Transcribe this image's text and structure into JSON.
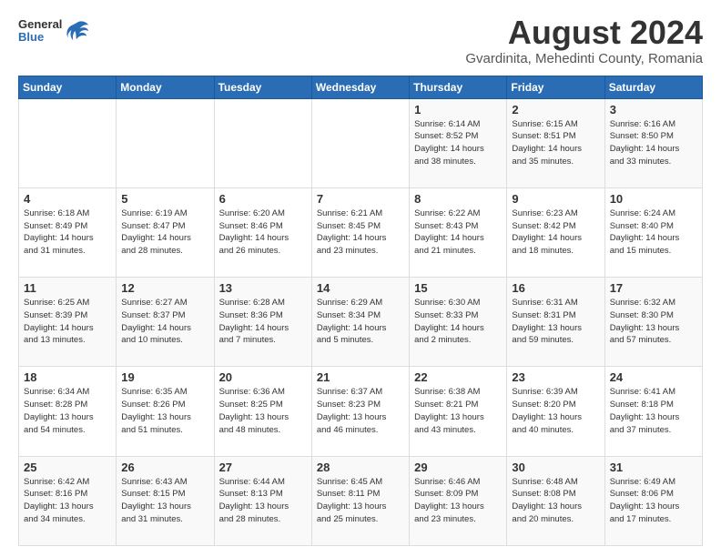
{
  "header": {
    "logo": {
      "general": "General",
      "blue": "Blue"
    },
    "title": "August 2024",
    "subtitle": "Gvardinita, Mehedinti County, Romania"
  },
  "weekdays": [
    "Sunday",
    "Monday",
    "Tuesday",
    "Wednesday",
    "Thursday",
    "Friday",
    "Saturday"
  ],
  "weeks": [
    [
      {
        "day": "",
        "info": ""
      },
      {
        "day": "",
        "info": ""
      },
      {
        "day": "",
        "info": ""
      },
      {
        "day": "",
        "info": ""
      },
      {
        "day": "1",
        "info": "Sunrise: 6:14 AM\nSunset: 8:52 PM\nDaylight: 14 hours\nand 38 minutes."
      },
      {
        "day": "2",
        "info": "Sunrise: 6:15 AM\nSunset: 8:51 PM\nDaylight: 14 hours\nand 35 minutes."
      },
      {
        "day": "3",
        "info": "Sunrise: 6:16 AM\nSunset: 8:50 PM\nDaylight: 14 hours\nand 33 minutes."
      }
    ],
    [
      {
        "day": "4",
        "info": "Sunrise: 6:18 AM\nSunset: 8:49 PM\nDaylight: 14 hours\nand 31 minutes."
      },
      {
        "day": "5",
        "info": "Sunrise: 6:19 AM\nSunset: 8:47 PM\nDaylight: 14 hours\nand 28 minutes."
      },
      {
        "day": "6",
        "info": "Sunrise: 6:20 AM\nSunset: 8:46 PM\nDaylight: 14 hours\nand 26 minutes."
      },
      {
        "day": "7",
        "info": "Sunrise: 6:21 AM\nSunset: 8:45 PM\nDaylight: 14 hours\nand 23 minutes."
      },
      {
        "day": "8",
        "info": "Sunrise: 6:22 AM\nSunset: 8:43 PM\nDaylight: 14 hours\nand 21 minutes."
      },
      {
        "day": "9",
        "info": "Sunrise: 6:23 AM\nSunset: 8:42 PM\nDaylight: 14 hours\nand 18 minutes."
      },
      {
        "day": "10",
        "info": "Sunrise: 6:24 AM\nSunset: 8:40 PM\nDaylight: 14 hours\nand 15 minutes."
      }
    ],
    [
      {
        "day": "11",
        "info": "Sunrise: 6:25 AM\nSunset: 8:39 PM\nDaylight: 14 hours\nand 13 minutes."
      },
      {
        "day": "12",
        "info": "Sunrise: 6:27 AM\nSunset: 8:37 PM\nDaylight: 14 hours\nand 10 minutes."
      },
      {
        "day": "13",
        "info": "Sunrise: 6:28 AM\nSunset: 8:36 PM\nDaylight: 14 hours\nand 7 minutes."
      },
      {
        "day": "14",
        "info": "Sunrise: 6:29 AM\nSunset: 8:34 PM\nDaylight: 14 hours\nand 5 minutes."
      },
      {
        "day": "15",
        "info": "Sunrise: 6:30 AM\nSunset: 8:33 PM\nDaylight: 14 hours\nand 2 minutes."
      },
      {
        "day": "16",
        "info": "Sunrise: 6:31 AM\nSunset: 8:31 PM\nDaylight: 13 hours\nand 59 minutes."
      },
      {
        "day": "17",
        "info": "Sunrise: 6:32 AM\nSunset: 8:30 PM\nDaylight: 13 hours\nand 57 minutes."
      }
    ],
    [
      {
        "day": "18",
        "info": "Sunrise: 6:34 AM\nSunset: 8:28 PM\nDaylight: 13 hours\nand 54 minutes."
      },
      {
        "day": "19",
        "info": "Sunrise: 6:35 AM\nSunset: 8:26 PM\nDaylight: 13 hours\nand 51 minutes."
      },
      {
        "day": "20",
        "info": "Sunrise: 6:36 AM\nSunset: 8:25 PM\nDaylight: 13 hours\nand 48 minutes."
      },
      {
        "day": "21",
        "info": "Sunrise: 6:37 AM\nSunset: 8:23 PM\nDaylight: 13 hours\nand 46 minutes."
      },
      {
        "day": "22",
        "info": "Sunrise: 6:38 AM\nSunset: 8:21 PM\nDaylight: 13 hours\nand 43 minutes."
      },
      {
        "day": "23",
        "info": "Sunrise: 6:39 AM\nSunset: 8:20 PM\nDaylight: 13 hours\nand 40 minutes."
      },
      {
        "day": "24",
        "info": "Sunrise: 6:41 AM\nSunset: 8:18 PM\nDaylight: 13 hours\nand 37 minutes."
      }
    ],
    [
      {
        "day": "25",
        "info": "Sunrise: 6:42 AM\nSunset: 8:16 PM\nDaylight: 13 hours\nand 34 minutes."
      },
      {
        "day": "26",
        "info": "Sunrise: 6:43 AM\nSunset: 8:15 PM\nDaylight: 13 hours\nand 31 minutes."
      },
      {
        "day": "27",
        "info": "Sunrise: 6:44 AM\nSunset: 8:13 PM\nDaylight: 13 hours\nand 28 minutes."
      },
      {
        "day": "28",
        "info": "Sunrise: 6:45 AM\nSunset: 8:11 PM\nDaylight: 13 hours\nand 25 minutes."
      },
      {
        "day": "29",
        "info": "Sunrise: 6:46 AM\nSunset: 8:09 PM\nDaylight: 13 hours\nand 23 minutes."
      },
      {
        "day": "30",
        "info": "Sunrise: 6:48 AM\nSunset: 8:08 PM\nDaylight: 13 hours\nand 20 minutes."
      },
      {
        "day": "31",
        "info": "Sunrise: 6:49 AM\nSunset: 8:06 PM\nDaylight: 13 hours\nand 17 minutes."
      }
    ]
  ]
}
